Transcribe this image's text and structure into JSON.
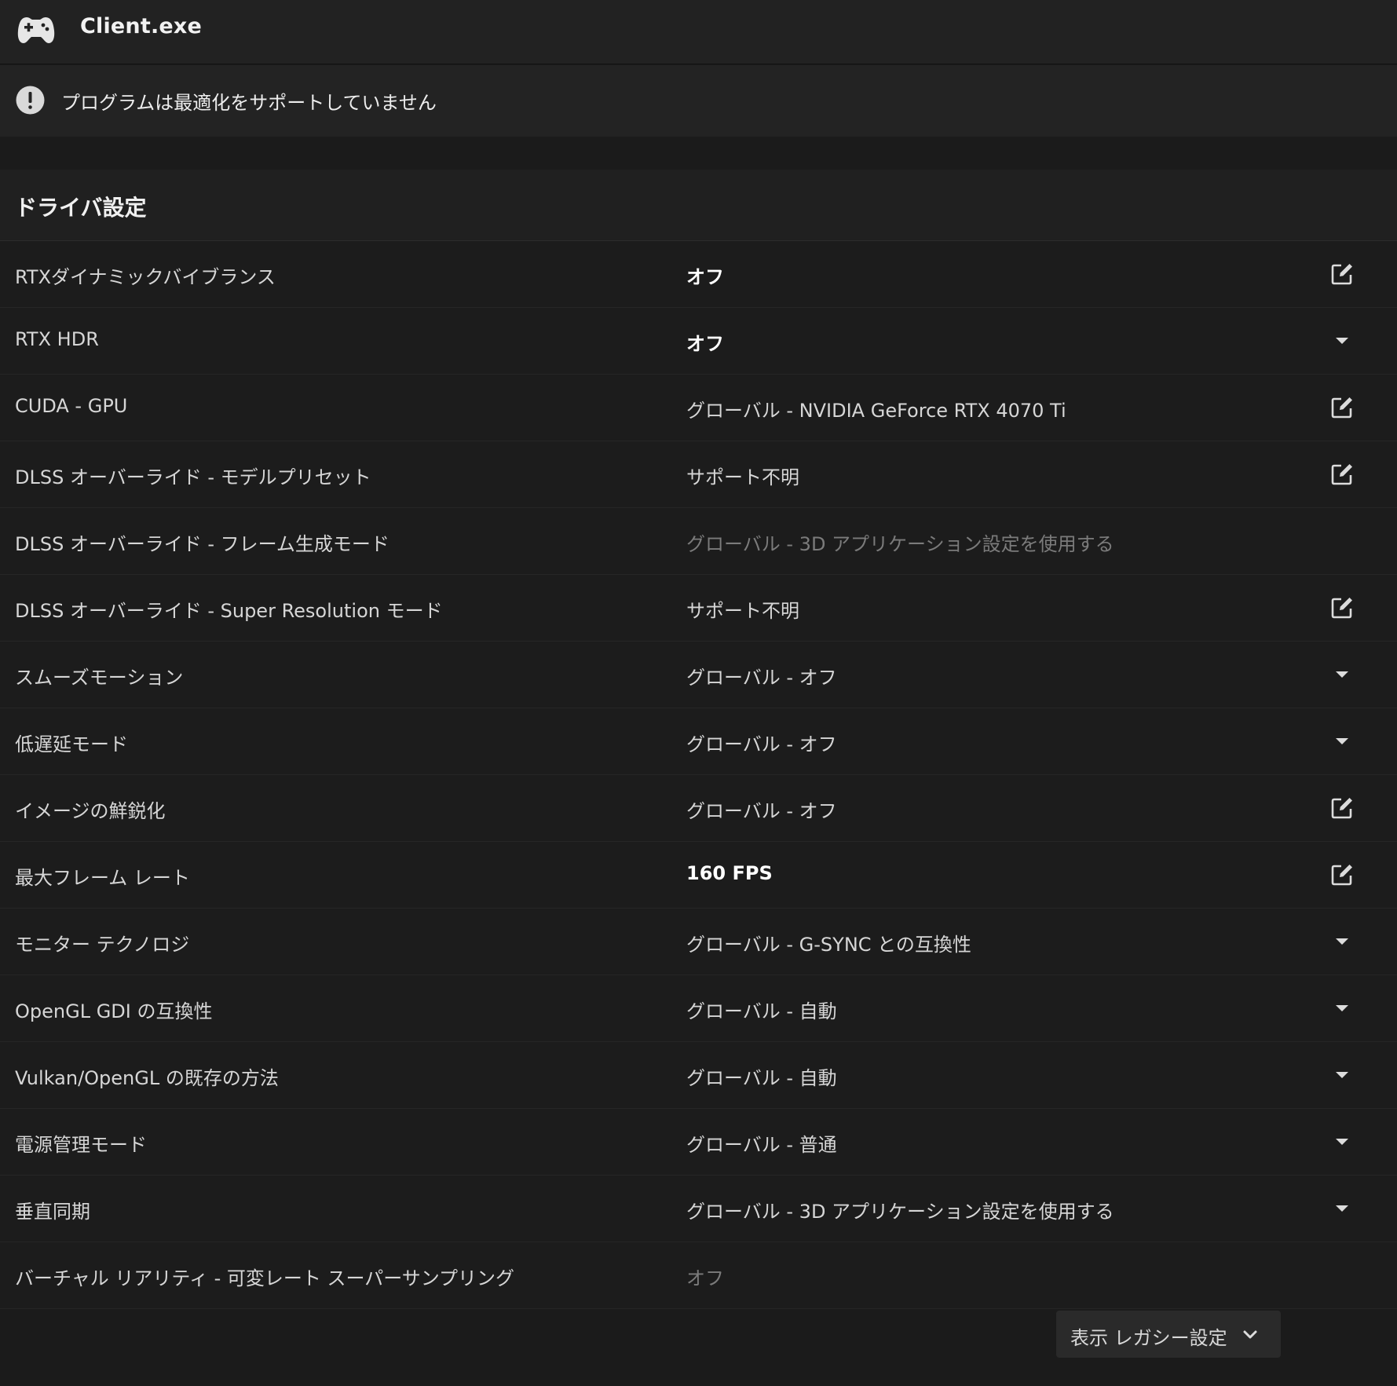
{
  "app": {
    "title": "Client.exe",
    "icon": "gamepad-icon"
  },
  "notice": {
    "icon": "exclamation-circle-icon",
    "text": "プログラムは最適化をサポートしていません"
  },
  "section": {
    "title": "ドライバ設定"
  },
  "settings": [
    {
      "label": "RTXダイナミックバイブランス",
      "value": "オフ",
      "style": "bold",
      "control": "edit-icon"
    },
    {
      "label": "RTX HDR",
      "value": "オフ",
      "style": "bold",
      "control": "dropdown-arrow-icon"
    },
    {
      "label": "CUDA - GPU",
      "value": "グローバル - NVIDIA GeForce RTX 4070 Ti",
      "style": "normal",
      "control": "edit-icon"
    },
    {
      "label": "DLSS オーバーライド - モデルプリセット",
      "value": "サポート不明",
      "style": "normal",
      "control": "edit-icon"
    },
    {
      "label": "DLSS オーバーライド - フレーム生成モード",
      "value": "グローバル - 3D アプリケーション設定を使用する",
      "style": "dim",
      "control": "none"
    },
    {
      "label": "DLSS オーバーライド - Super Resolution モード",
      "value": "サポート不明",
      "style": "normal",
      "control": "edit-icon"
    },
    {
      "label": "スムーズモーション",
      "value": "グローバル - オフ",
      "style": "normal",
      "control": "dropdown-arrow-icon"
    },
    {
      "label": "低遅延モード",
      "value": "グローバル - オフ",
      "style": "normal",
      "control": "dropdown-arrow-icon"
    },
    {
      "label": "イメージの鮮鋭化",
      "value": "グローバル - オフ",
      "style": "normal",
      "control": "edit-icon"
    },
    {
      "label": "最大フレーム レート",
      "value": "160 FPS",
      "style": "bold",
      "control": "edit-icon"
    },
    {
      "label": "モニター テクノロジ",
      "value": "グローバル - G-SYNC との互換性",
      "style": "normal",
      "control": "dropdown-arrow-icon"
    },
    {
      "label": "OpenGL GDI の互換性",
      "value": "グローバル - 自動",
      "style": "normal",
      "control": "dropdown-arrow-icon"
    },
    {
      "label": "Vulkan/OpenGL の既存の方法",
      "value": "グローバル - 自動",
      "style": "normal",
      "control": "dropdown-arrow-icon"
    },
    {
      "label": "電源管理モード",
      "value": "グローバル - 普通",
      "style": "normal",
      "control": "dropdown-arrow-icon"
    },
    {
      "label": "垂直同期",
      "value": "グローバル - 3D アプリケーション設定を使用する",
      "style": "normal",
      "control": "dropdown-arrow-icon"
    },
    {
      "label": "バーチャル リアリティ - 可変レート スーパーサンプリング",
      "value": "オフ",
      "style": "dim",
      "control": "none"
    }
  ],
  "legacy": {
    "label": "表示 レガシー設定",
    "icon": "chevron-down-icon"
  },
  "colors": {
    "background": "#1b1b1b",
    "header": "#222222",
    "row": "#1c1c1c",
    "text": "#d6d6d6",
    "dim_text": "#7b7b7b",
    "bold_text": "#ffffff"
  }
}
